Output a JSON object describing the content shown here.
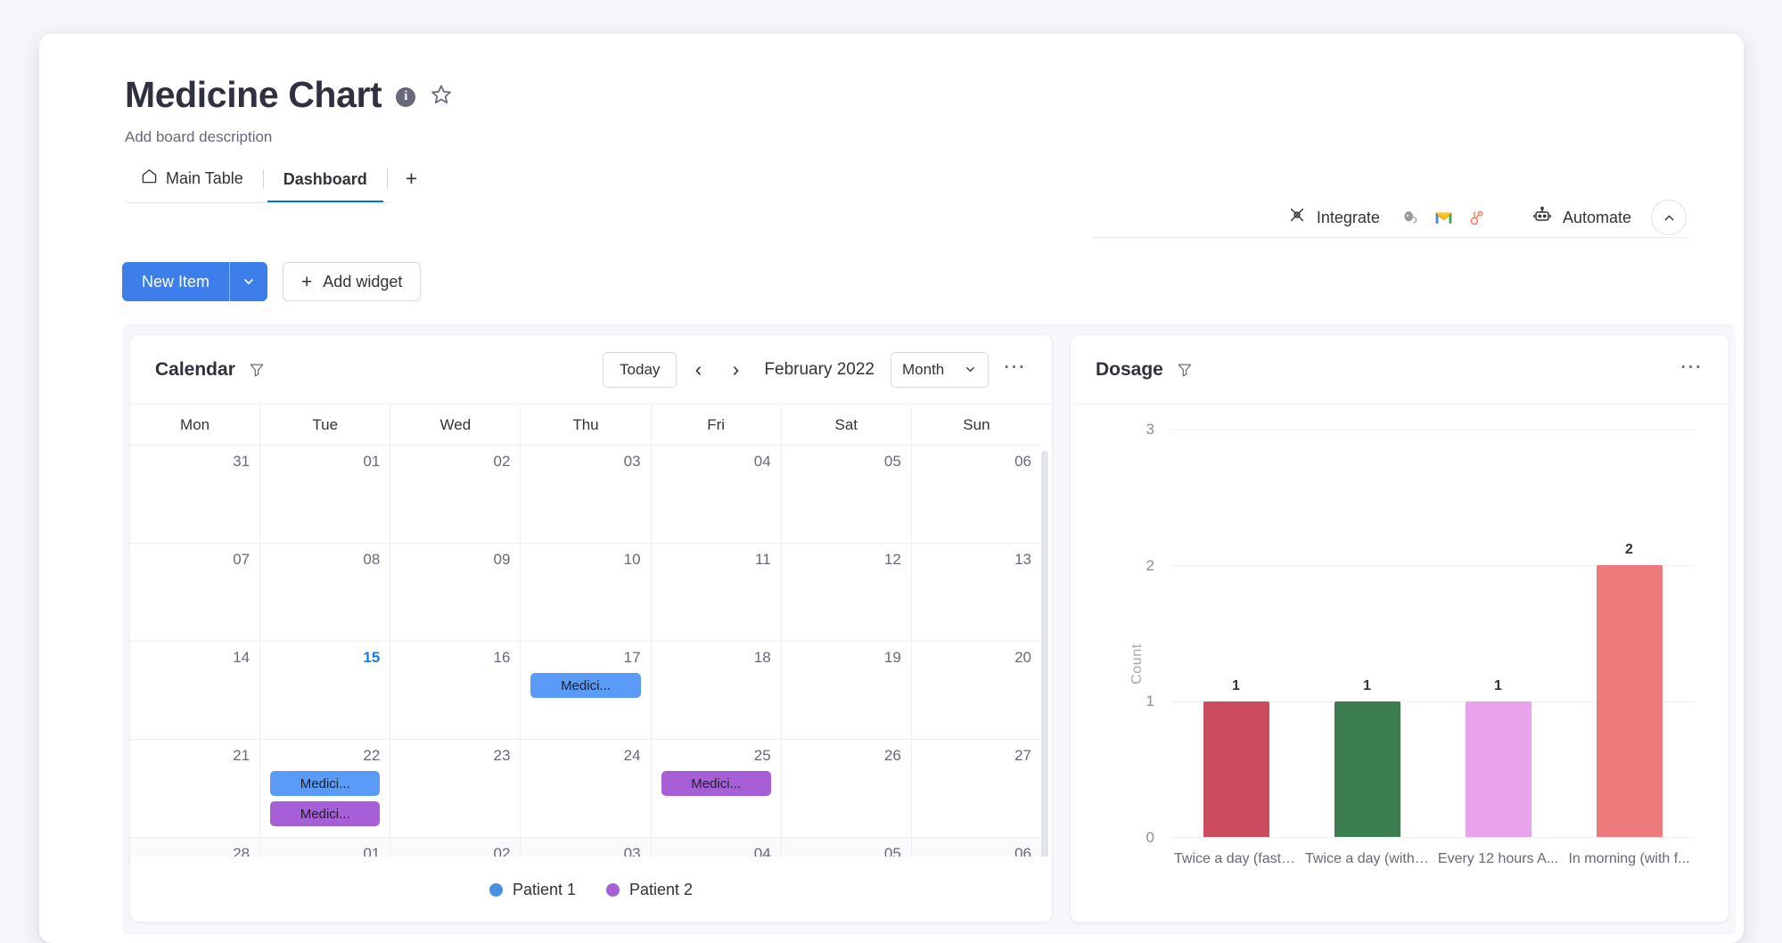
{
  "board": {
    "title": "Medicine Chart",
    "description": "Add board description",
    "info_icon": "info-icon",
    "star_icon": "star-icon"
  },
  "tabs": [
    {
      "label": "Main Table",
      "icon": "home-icon",
      "active": false
    },
    {
      "label": "Dashboard",
      "icon": "",
      "active": true
    }
  ],
  "tab_add_label": "+",
  "header_actions": {
    "integrate_label": "Integrate",
    "integrate_icon": "integrate-icon",
    "automate_label": "Automate",
    "automate_icon": "robot-icon",
    "collapse_icon": "chevron-up-icon",
    "integrations": [
      {
        "name": "mailchimp-icon"
      },
      {
        "name": "gmail-icon"
      },
      {
        "name": "hubspot-icon"
      }
    ]
  },
  "toolbar": {
    "new_item_label": "New Item",
    "new_item_caret": "chevron-down-icon",
    "add_widget_label": "Add widget",
    "add_widget_plus": "+",
    "accent_color": "#3e7eea"
  },
  "calendar": {
    "title": "Calendar",
    "filter_icon": "filter-icon",
    "today_label": "Today",
    "prev_label": "‹",
    "next_label": "›",
    "month_label": "February 2022",
    "view_value": "Month",
    "view_caret": "chevron-down-icon",
    "menu_label": "⋯",
    "weekdays": [
      "Mon",
      "Tue",
      "Wed",
      "Thu",
      "Fri",
      "Sat",
      "Sun"
    ],
    "weeks": [
      {
        "trailing": false,
        "days": [
          {
            "num": "31",
            "today": false,
            "events": []
          },
          {
            "num": "01",
            "today": false,
            "events": []
          },
          {
            "num": "02",
            "today": false,
            "events": []
          },
          {
            "num": "03",
            "today": false,
            "events": []
          },
          {
            "num": "04",
            "today": false,
            "events": []
          },
          {
            "num": "05",
            "today": false,
            "events": []
          },
          {
            "num": "06",
            "today": false,
            "events": []
          }
        ]
      },
      {
        "trailing": false,
        "days": [
          {
            "num": "07",
            "today": false,
            "events": []
          },
          {
            "num": "08",
            "today": false,
            "events": []
          },
          {
            "num": "09",
            "today": false,
            "events": []
          },
          {
            "num": "10",
            "today": false,
            "events": []
          },
          {
            "num": "11",
            "today": false,
            "events": []
          },
          {
            "num": "12",
            "today": false,
            "events": []
          },
          {
            "num": "13",
            "today": false,
            "events": []
          }
        ]
      },
      {
        "trailing": false,
        "days": [
          {
            "num": "14",
            "today": false,
            "events": []
          },
          {
            "num": "15",
            "today": true,
            "events": []
          },
          {
            "num": "16",
            "today": false,
            "events": []
          },
          {
            "num": "17",
            "today": false,
            "events": [
              {
                "label": "Medici...",
                "color": "#5b9bf8"
              }
            ]
          },
          {
            "num": "18",
            "today": false,
            "events": []
          },
          {
            "num": "19",
            "today": false,
            "events": []
          },
          {
            "num": "20",
            "today": false,
            "events": []
          }
        ]
      },
      {
        "trailing": false,
        "days": [
          {
            "num": "21",
            "today": false,
            "events": []
          },
          {
            "num": "22",
            "today": false,
            "events": [
              {
                "label": "Medici...",
                "color": "#5b9bf8"
              },
              {
                "label": "Medici...",
                "color": "#a martin"
              }
            ]
          },
          {
            "num": "23",
            "today": false,
            "events": []
          },
          {
            "num": "24",
            "today": false,
            "events": []
          },
          {
            "num": "25",
            "today": false,
            "events": [
              {
                "label": "Medici...",
                "color": "#a martin"
              }
            ]
          },
          {
            "num": "26",
            "today": false,
            "events": []
          },
          {
            "num": "27",
            "today": false,
            "events": []
          }
        ]
      },
      {
        "trailing": true,
        "days": [
          {
            "num": "28",
            "today": false,
            "events": []
          },
          {
            "num": "01",
            "today": false,
            "events": []
          },
          {
            "num": "02",
            "today": false,
            "events": []
          },
          {
            "num": "03",
            "today": false,
            "events": []
          },
          {
            "num": "04",
            "today": false,
            "events": []
          },
          {
            "num": "05",
            "today": false,
            "events": []
          },
          {
            "num": "06",
            "today": false,
            "events": []
          }
        ]
      }
    ],
    "legend": [
      {
        "label": "Patient 1",
        "color": "#4a90e2"
      },
      {
        "label": "Patient 2",
        "color": "#a githubusercontent"
      }
    ]
  },
  "dosage": {
    "title": "Dosage",
    "filter_icon": "filter-icon",
    "menu_label": "⋯"
  },
  "chart_data": {
    "type": "bar",
    "title": "Dosage",
    "xlabel": "",
    "ylabel": "Count",
    "ylim": [
      0,
      3
    ],
    "yticks": [
      0,
      1,
      2,
      3
    ],
    "grid": true,
    "legend": "none",
    "categories": [
      "Twice a day (faste...",
      "Twice a day (with ...",
      "Every 12 hours A...",
      "In morning (with f..."
    ],
    "values": [
      1,
      1,
      1,
      2
    ],
    "colors": [
      "#cc4b5e",
      "#3b7d4f",
      "#e8a3eb",
      "#ec7a7a"
    ],
    "data_labels": [
      "1",
      "1",
      "1",
      "2"
    ]
  }
}
